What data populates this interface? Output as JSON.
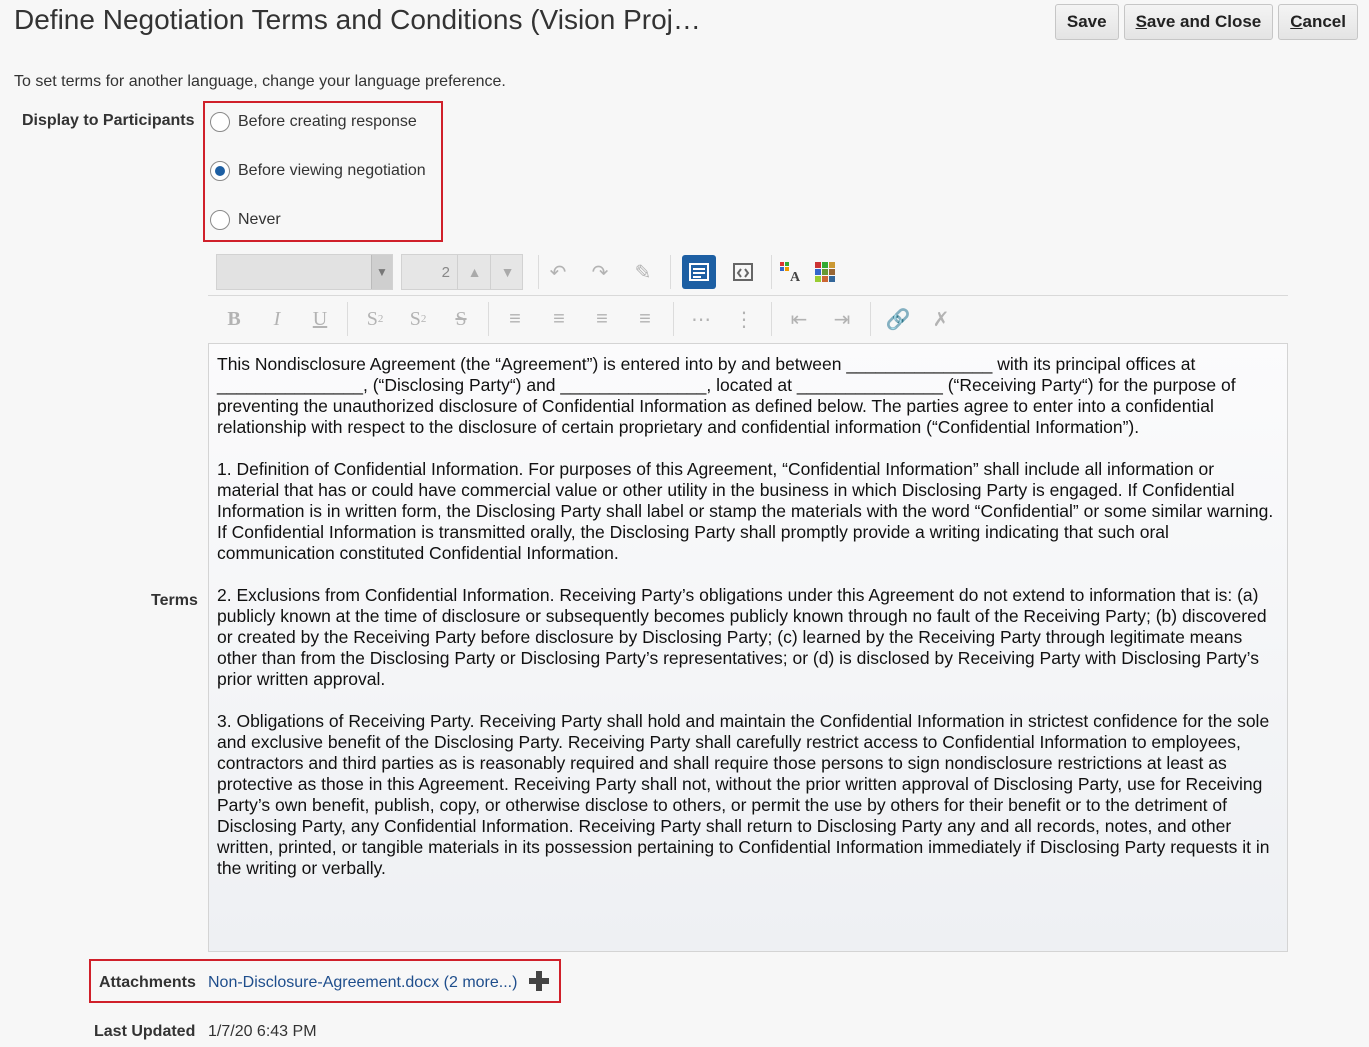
{
  "header": {
    "title": "Define Negotiation Terms and Conditions (Vision Proj…",
    "buttons": {
      "save": "Save",
      "save_and_close": "Save and Close",
      "cancel": "Cancel"
    }
  },
  "instruction": "To set terms for another language, change your language preference.",
  "display_to_participants": {
    "label": "Display to Participants",
    "options": [
      {
        "label": "Before creating response",
        "selected": false
      },
      {
        "label": "Before viewing negotiation",
        "selected": true
      },
      {
        "label": "Never",
        "selected": false
      }
    ]
  },
  "editor_toolbar": {
    "font_size": "2",
    "icons_row1": [
      "undo-icon",
      "redo-icon",
      "clear-format-icon",
      "rich-text-mode-icon",
      "source-code-mode-icon",
      "text-color-icon",
      "background-color-icon"
    ],
    "icons_row2": [
      "bold-icon",
      "italic-icon",
      "underline-icon",
      "subscript-icon",
      "superscript-icon",
      "strikethrough-icon",
      "align-left-icon",
      "align-center-icon",
      "align-right-icon",
      "justify-icon",
      "bullet-list-icon",
      "numbered-list-icon",
      "outdent-icon",
      "indent-icon",
      "link-icon",
      "unlink-icon"
    ]
  },
  "terms": {
    "label": "Terms",
    "paragraphs": [
      "This Nondisclosure Agreement (the “Agreement”) is entered into by and between _______________ with its principal offices at _______________, (“Disclosing Party“) and _______________, located at _______________ (“Receiving Party“) for the purpose of preventing the unauthorized disclosure of Confidential Information as defined below. The parties agree to enter into a confidential relationship with respect to the disclosure of certain proprietary and confidential information (“Confidential Information”).",
      "1.   Definition of Confidential Information. For purposes of this Agreement, “Confidential Information” shall include all information or material that has or could have commercial value or other utility in the business in which Disclosing Party is engaged. If Confidential Information is in written form, the Disclosing Party shall label or stamp the materials with the word “Confidential” or some similar warning. If Confidential Information is transmitted orally, the Disclosing Party shall promptly provide a writing indicating that such oral communication constituted Confidential Information.",
      "2.   Exclusions from Confidential Information. Receiving Party’s obligations under this Agreement do not extend to information that is: (a) publicly known at the time of disclosure or subsequently becomes publicly known through no fault of the Receiving Party; (b) discovered or created by the Receiving Party before disclosure by Disclosing Party; (c) learned by the Receiving Party through legitimate means other than from the Disclosing Party or Disclosing Party’s representatives; or (d) is disclosed by Receiving Party with Disclosing Party’s prior written approval.",
      "3.   Obligations of Receiving Party. Receiving Party shall hold and maintain the Confidential Information in strictest confidence for the sole and exclusive benefit of the Disclosing Party. Receiving Party shall carefully restrict access to Confidential Information to employees, contractors and third parties as is reasonably required and shall require those persons to sign nondisclosure restrictions at least as protective as those in this Agreement. Receiving Party shall not, without the prior written approval of Disclosing Party, use for Receiving Party’s own benefit, publish, copy, or otherwise disclose to others, or permit the use by others for their benefit or to the detriment of Disclosing Party, any Confidential Information. Receiving Party shall return to Disclosing Party any and all records, notes, and other written, printed, or tangible materials in its possession pertaining to Confidential Information immediately if Disclosing Party requests it in the writing or verbally."
    ]
  },
  "attachments": {
    "label": "Attachments",
    "link_text": "Non-Disclosure-Agreement.docx (2 more...)"
  },
  "last_updated": {
    "label": "Last Updated",
    "value": "1/7/20 6:43 PM"
  },
  "colors": {
    "highlight_border": "#d0202a",
    "accent": "#1d5fa3",
    "link": "#1f4e8c"
  }
}
